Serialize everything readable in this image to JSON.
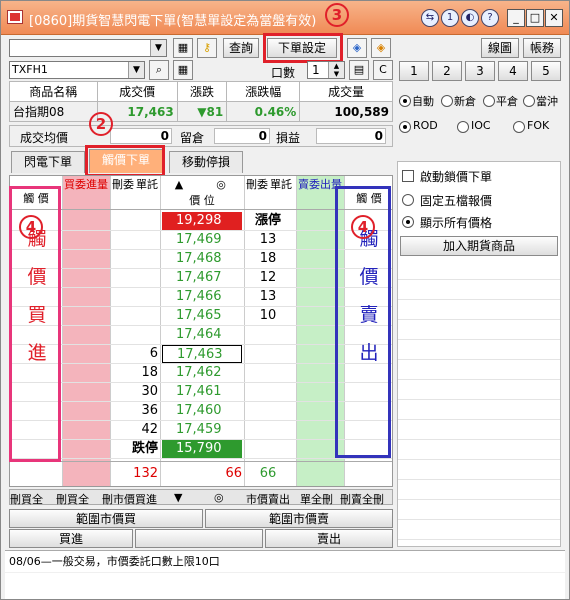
{
  "titlebar": {
    "title": "[0860]期貨智慧閃電下單(智慧單設定為當盤有效)"
  },
  "annotations": {
    "a2": "2",
    "a3": "3",
    "a4l": "4",
    "a4r": "4"
  },
  "toolbar": {
    "account_select": "",
    "query": "查詢",
    "order_settings": "下單設定",
    "chart": "線圖",
    "account": "帳務",
    "symbol": "TXFH1",
    "qty_label": "口數",
    "qty_value": "1",
    "c_label": "C",
    "qty_presets": [
      "1",
      "2",
      "3",
      "4",
      "5"
    ]
  },
  "info": {
    "headers": [
      "商品名稱",
      "成交價",
      "漲跌",
      "漲跌幅",
      "成交量"
    ],
    "product": "台指期08",
    "price": "17,463",
    "change": "▼81",
    "change_pct": "0.46%",
    "volume": "100,589",
    "avg_label": "成交均價",
    "avg_value": "0",
    "pos_label": "留倉",
    "pos_value": "0",
    "pl_label": "損益",
    "pl_value": "0"
  },
  "tabs": [
    "閃電下單",
    "觸價下單",
    "移動停損"
  ],
  "grid": {
    "headers": {
      "left_trigger": "觸 價",
      "buy_order": "買委",
      "buy_qty": "進量",
      "del_order": "刪委",
      "order_cnt": "單託",
      "up_arrow": "▲",
      "center": "◎",
      "price": "價 位",
      "del2": "刪委",
      "order2": "單託",
      "sell_order": "賣委",
      "sell_qty": "出量",
      "right_trigger": "觸 價"
    },
    "prices": [
      "19,298",
      "17,469",
      "17,468",
      "17,467",
      "17,466",
      "17,465",
      "17,464",
      "17,463",
      "17,462",
      "17,461",
      "17,460",
      "17,459",
      "15,790"
    ],
    "bid_qty": [
      "",
      "",
      "",
      "",
      "",
      "",
      "",
      "6",
      "18",
      "30",
      "36",
      "42",
      ""
    ],
    "ask_qty": [
      "漲停",
      "13",
      "18",
      "12",
      "13",
      "10",
      "",
      "",
      "",
      "",
      "",
      "",
      ""
    ],
    "limit_down": "跌停",
    "totals": {
      "left": "132",
      "mid": "66",
      "right": "66"
    },
    "left_big": "觸價買進",
    "right_big": "觸價賣出"
  },
  "bottom": {
    "del_buy_all": "刪買全",
    "del_buy_order": "刪買全",
    "del_market_buy": "刪市價買進",
    "down_arrow": "▼",
    "center": "◎",
    "market_sell": "市價賣出",
    "del_sell_all": "單全刪",
    "del_sell": "刪賣全刪",
    "range_buy": "範圍市價買",
    "range_sell": "範圍市價賣",
    "buy": "買進",
    "sell": "賣出"
  },
  "right_panel": {
    "radios1": [
      "自動",
      "新倉",
      "平倉",
      "當沖"
    ],
    "radios2": [
      "ROD",
      "IOC",
      "FOK"
    ],
    "enable_stop": "啟動鎖價下單",
    "fixed_five": "固定五檔報價",
    "show_all": "顯示所有價格",
    "add_product": "加入期貨商品"
  },
  "status": "08/06—一般交易，市價委託口數上限10口",
  "colors": {
    "title_bg": "#f08a55",
    "red": "#e0202a",
    "blue": "#3333bb",
    "green": "#2e9a2e",
    "pink": "#f4b4bc",
    "lightgreen": "#c6efc6"
  }
}
